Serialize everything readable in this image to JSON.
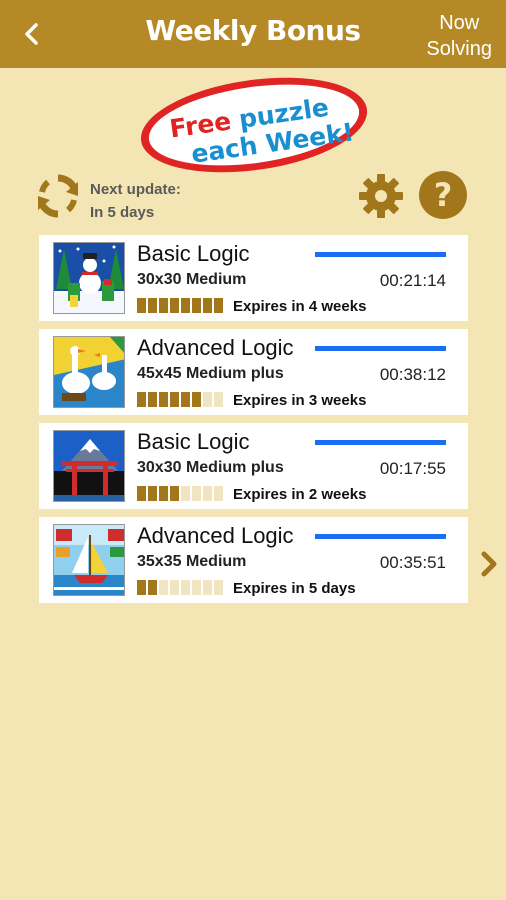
{
  "header": {
    "title": "Weekly Bonus",
    "now_solving_line1": "Now",
    "now_solving_line2": "Solving"
  },
  "badge": {
    "word1": "Free",
    "word2": "puzzle",
    "line2": "each Week!"
  },
  "update": {
    "label": "Next update:",
    "value": "In 5 days"
  },
  "colors": {
    "topbar": "#b58a26",
    "background": "#f4e6b4",
    "accent_gold": "#a2761a",
    "progress_blue": "#1b6ef3",
    "badge_red": "#e02424"
  },
  "icons": [
    "back-arrow-icon",
    "refresh-icon",
    "gear-icon",
    "help-icon",
    "chevron-right-icon"
  ],
  "puzzles": [
    {
      "title": "Basic Logic",
      "size": "30x30 Medium",
      "time": "00:21:14",
      "progress": 1.0,
      "segments_filled": 8,
      "segments_total": 8,
      "expires": "Expires in 4 weeks"
    },
    {
      "title": "Advanced Logic",
      "size": "45x45 Medium plus",
      "time": "00:38:12",
      "progress": 1.0,
      "segments_filled": 6,
      "segments_total": 8,
      "expires": "Expires in 3 weeks"
    },
    {
      "title": "Basic Logic",
      "size": "30x30 Medium plus",
      "time": "00:17:55",
      "progress": 1.0,
      "segments_filled": 4,
      "segments_total": 8,
      "expires": "Expires in 2 weeks"
    },
    {
      "title": "Advanced Logic",
      "size": "35x35 Medium",
      "time": "00:35:51",
      "progress": 1.0,
      "segments_filled": 2,
      "segments_total": 8,
      "expires": "Expires in 5 days"
    }
  ]
}
